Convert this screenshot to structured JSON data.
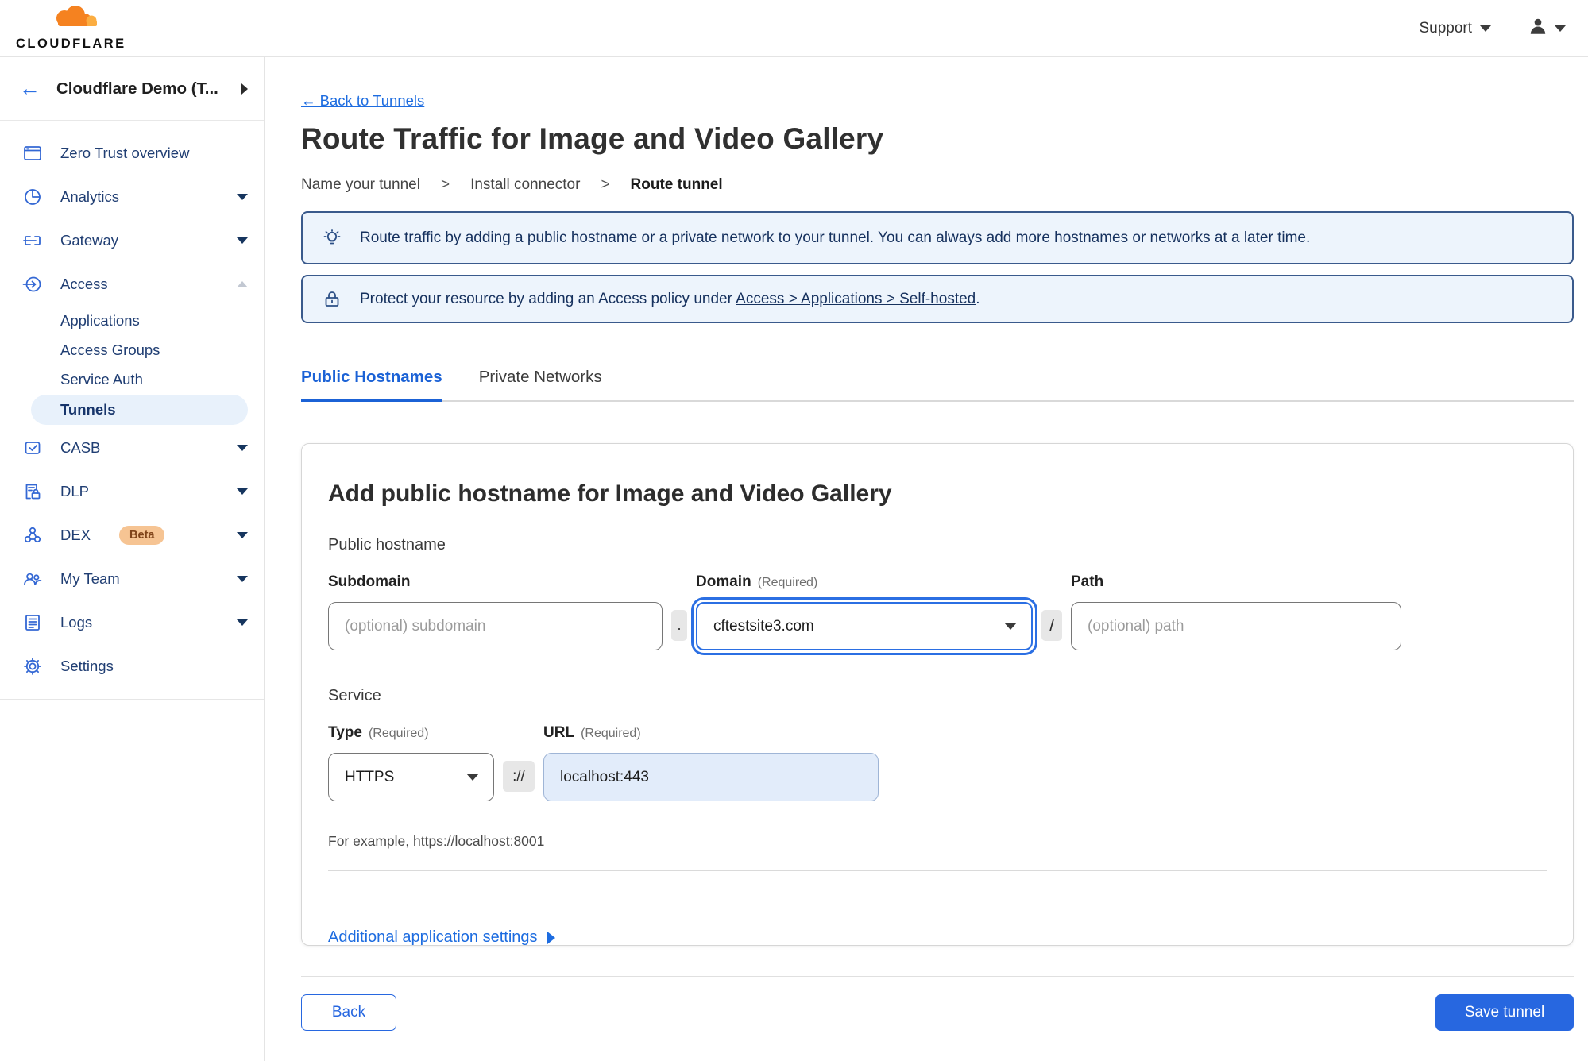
{
  "topbar": {
    "logo_text": "CLOUDFLARE",
    "support_label": "Support"
  },
  "sidebar": {
    "header": {
      "title": "Cloudflare Demo (T..."
    },
    "items": [
      {
        "label": "Zero Trust overview"
      },
      {
        "label": "Analytics",
        "chevron": "down"
      },
      {
        "label": "Gateway",
        "chevron": "down"
      },
      {
        "label": "Access",
        "chevron": "up",
        "expanded": true
      },
      {
        "label": "CASB",
        "chevron": "down"
      },
      {
        "label": "DLP",
        "chevron": "down"
      },
      {
        "label": "DEX",
        "badge": "Beta",
        "chevron": "down"
      },
      {
        "label": "My Team",
        "chevron": "down"
      },
      {
        "label": "Logs",
        "chevron": "down"
      },
      {
        "label": "Settings"
      }
    ],
    "access_children": [
      {
        "label": "Applications"
      },
      {
        "label": "Access Groups"
      },
      {
        "label": "Service Auth"
      },
      {
        "label": "Tunnels",
        "active": true
      }
    ]
  },
  "main": {
    "back_link": "← Back to Tunnels",
    "title": "Route Traffic for Image and Video Gallery",
    "breadcrumb": {
      "step1": "Name your tunnel",
      "sep1": ">",
      "step2": "Install connector",
      "sep2": ">",
      "step3": "Route tunnel"
    },
    "banners": {
      "tip": "Route traffic by adding a public hostname or a private network to your tunnel. You can always add more hostnames or networks at a later time.",
      "lock_prefix": "Protect your resource by adding an Access policy under",
      "lock_link": "Access > Applications > Self-hosted",
      "lock_suffix": "."
    },
    "tabs": {
      "public": "Public Hostnames",
      "private": "Private Networks"
    },
    "card": {
      "heading": "Add public hostname for Image and Video Gallery",
      "public_hostname_label": "Public hostname",
      "subdomain_label": "Subdomain",
      "subdomain_placeholder": "(optional) subdomain",
      "dot": ".",
      "domain_label": "Domain",
      "required": "(Required)",
      "domain_value": "cftestsite3.com",
      "slash": "/",
      "path_label": "Path",
      "path_placeholder": "(optional) path",
      "service_label": "Service",
      "type_label": "Type",
      "type_value": "HTTPS",
      "scheme_sep": "://",
      "url_label": "URL",
      "url_value": "localhost:443",
      "example": "For example, https://localhost:8001",
      "additional_settings": "Additional application settings"
    },
    "buttons": {
      "back": "Back",
      "save": "Save tunnel"
    }
  },
  "colors": {
    "accent": "#2767e0",
    "link": "#1d6ce0",
    "banner_bg": "#edf4fc",
    "banner_border": "#3a5a8c",
    "active_pill_bg": "#e8f1fb",
    "beta_bg": "#f6c493",
    "beta_text": "#80441a",
    "save_button_bg": "#2767e0"
  }
}
